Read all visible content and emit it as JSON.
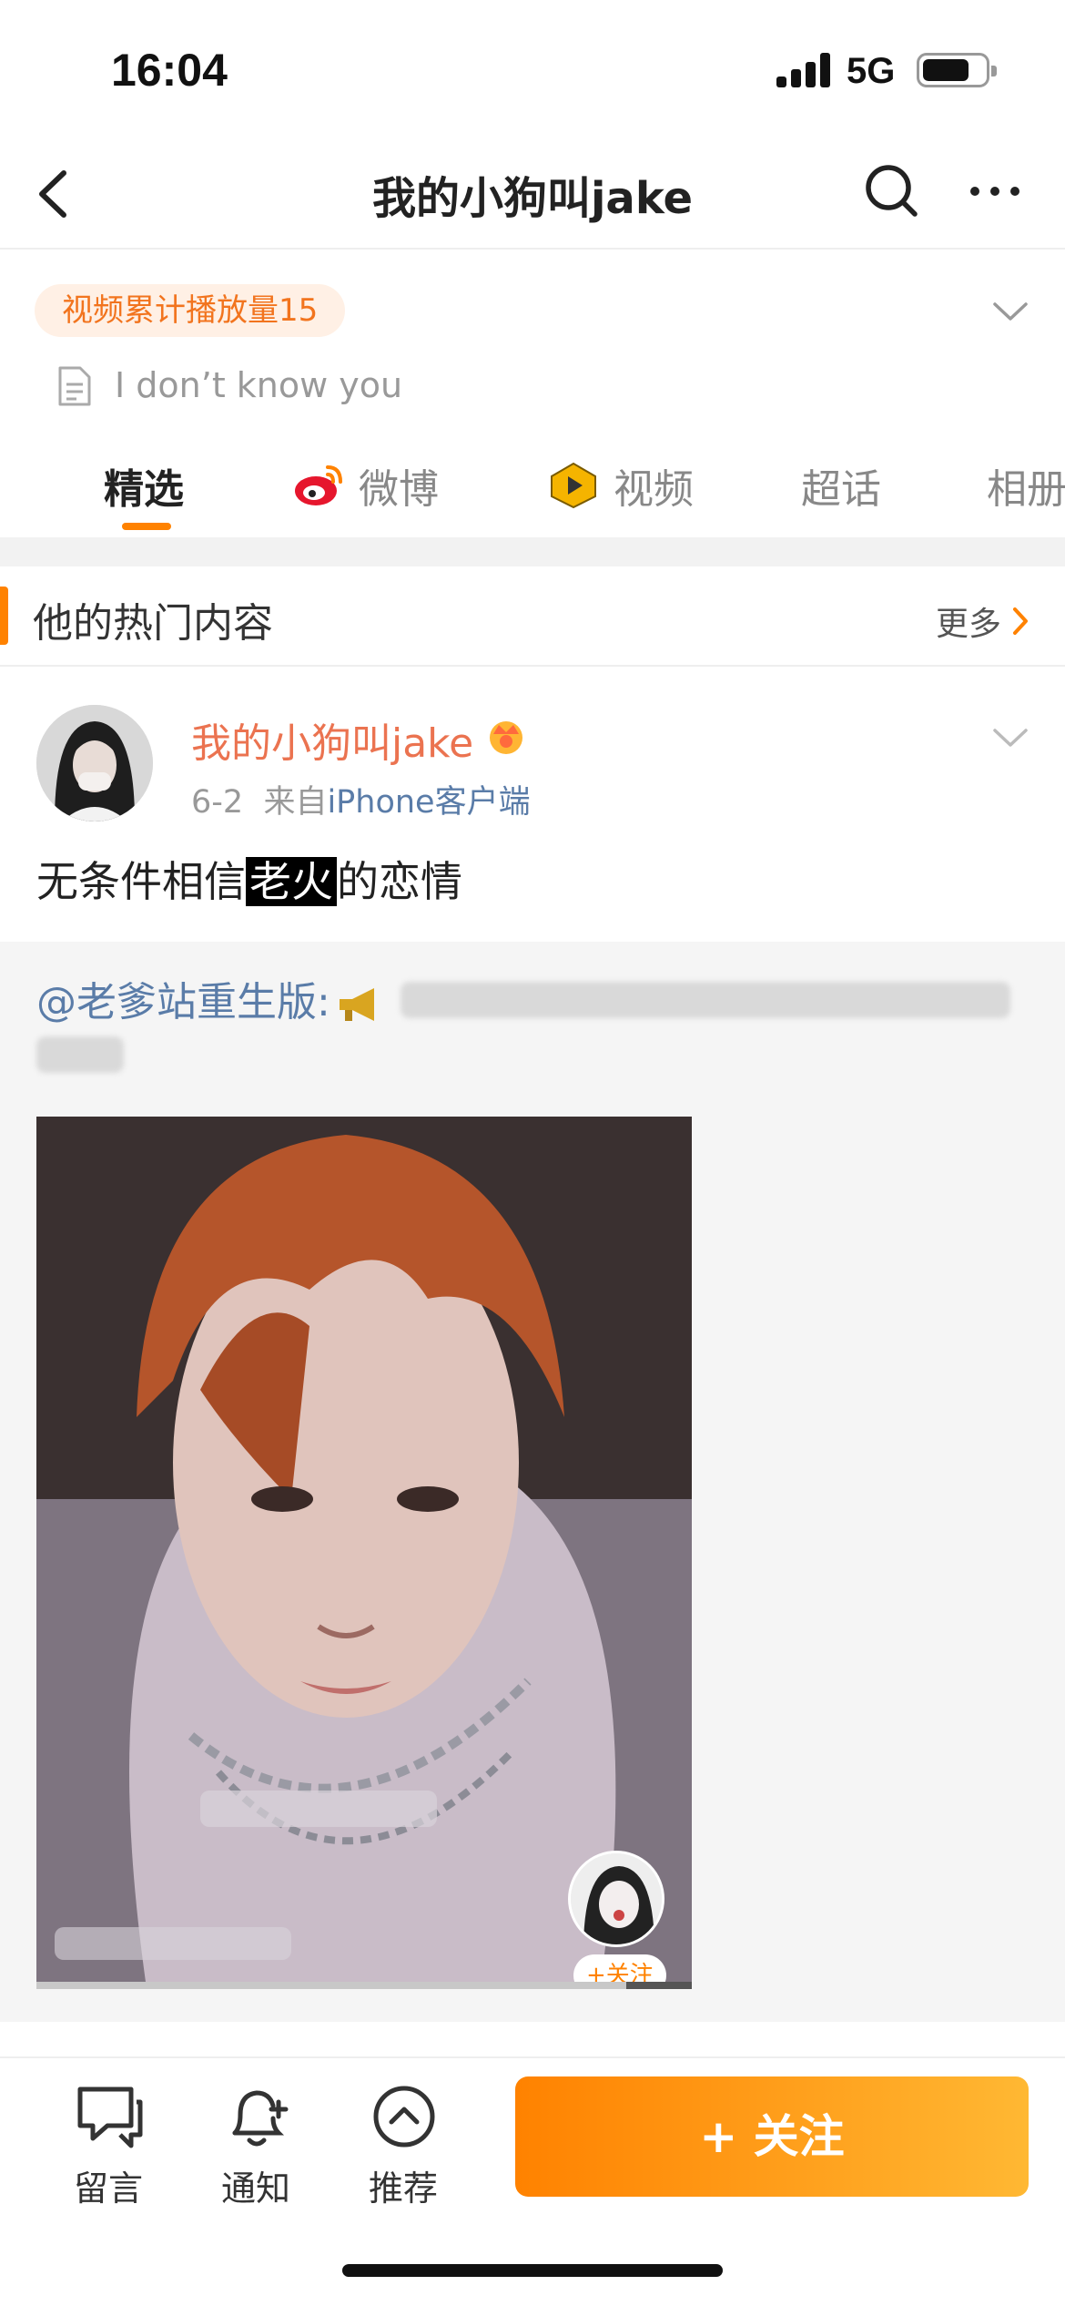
{
  "status_bar": {
    "time": "16:04",
    "network": "5G",
    "battery_level": 0.75
  },
  "nav": {
    "title": "我的小狗叫jake"
  },
  "profile": {
    "play_count_badge": "视频累计播放量15",
    "bio": "I don’t know you"
  },
  "tabs": [
    {
      "label": "精选",
      "active": true
    },
    {
      "label": "微博",
      "icon": "weibo-icon"
    },
    {
      "label": "视频",
      "icon": "video-icon"
    },
    {
      "label": "超话"
    },
    {
      "label": "相册"
    }
  ],
  "section": {
    "title": "他的热门内容",
    "more": "更多"
  },
  "post": {
    "username": "我的小狗叫jake",
    "badge_icon": "crown-icon",
    "date": "6-2",
    "source_prefix": "来自",
    "source": "iPhone客户端",
    "text_before": "无条件相信",
    "text_highlight": "老火",
    "text_after": "的恋情",
    "repost_author": "@老爹站重生版:",
    "video_follow_chip": "+关注"
  },
  "bottom_bar": {
    "comment_label": "留言",
    "notify_label": "通知",
    "recommend_label": "推荐",
    "follow_label": "+ 关注"
  },
  "colors": {
    "accent": "#ff8200",
    "username": "#eb7350",
    "link": "#5a7ca8"
  }
}
